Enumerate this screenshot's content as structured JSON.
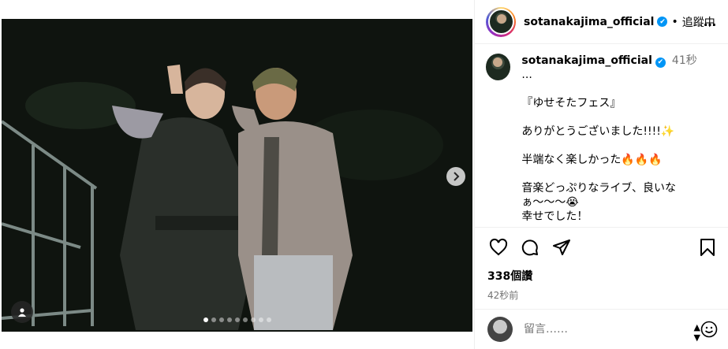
{
  "post": {
    "username": "sotanakajima_official",
    "separator": "•",
    "follow_label": "追蹤中",
    "more_label": "…",
    "caption_time": "41秒",
    "caption_ellipsis": "...",
    "caption_lines": [
      "『ゆせそたフェス』",
      "ありがとうございました!!!!✨",
      "半端なく楽しかった🔥🔥🔥",
      "音楽どっぷりなライブ、良いなぁ〜〜〜😭",
      "幸せでした！"
    ],
    "likes": "338個讚",
    "posted_ago": "42秒前",
    "comment_placeholder": "留言……",
    "carousel_total": 9,
    "carousel_active": 0
  },
  "icons": [
    "heart-icon",
    "comment-icon",
    "share-icon",
    "bookmark-icon",
    "chevron-right-icon",
    "user-tag-icon",
    "emoji-icon",
    "verified-icon",
    "more-icon"
  ],
  "colors": {
    "verified": "#0095f6",
    "secondary_text": "#737373",
    "divider": "#efefef"
  }
}
